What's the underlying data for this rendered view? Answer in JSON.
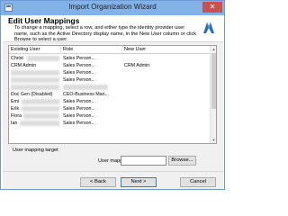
{
  "window": {
    "title": "Import Organization Wizard",
    "close_glyph": "✕"
  },
  "header": {
    "title": "Edit User Mappings",
    "description": "To change a mapping, select a row, and either type the identity provider user name, such as the Active Directory display name, in the New User column or click Browse to select a user.",
    "logo_icon": "dynamics-logo-icon"
  },
  "grid": {
    "columns": [
      "Existing User",
      "Role",
      "New User"
    ],
    "rows": [
      {
        "existing": "Christ",
        "role": "Sales Person...",
        "new_user": ""
      },
      {
        "existing": "CRM Admin",
        "role": "Sales Person...",
        "new_user": "CRM Admin"
      },
      {
        "existing": "",
        "role": "Sales Person...",
        "new_user": ""
      },
      {
        "existing": "",
        "role": "Sales Person...",
        "new_user": ""
      },
      {
        "existing": "",
        "role": "",
        "new_user": ""
      },
      {
        "existing": "Doc Gen (Disabled)",
        "role": "CEO-Business Man...",
        "new_user": ""
      },
      {
        "existing": "Emi",
        "role": "Sales Person...",
        "new_user": ""
      },
      {
        "existing": "Erik",
        "role": "Sales Person...",
        "new_user": ""
      },
      {
        "existing": "Flora",
        "role": "Sales Person...",
        "new_user": ""
      },
      {
        "existing": "Ian",
        "role": "Sales Person...",
        "new_user": ""
      }
    ],
    "scroll_up_glyph": "▲",
    "scroll_down_glyph": "▼"
  },
  "target": {
    "section_label": "User mapping target",
    "mapping_label": "User mapping:",
    "mapping_value": "",
    "browse_label": "Browse..."
  },
  "footer": {
    "back_label": "< Back",
    "next_label": "Next >",
    "cancel_label": "Cancel"
  },
  "colors": {
    "titlebar": "#83b2e8",
    "close_button": "#c75050",
    "accent_border": "#3c7fb1"
  }
}
